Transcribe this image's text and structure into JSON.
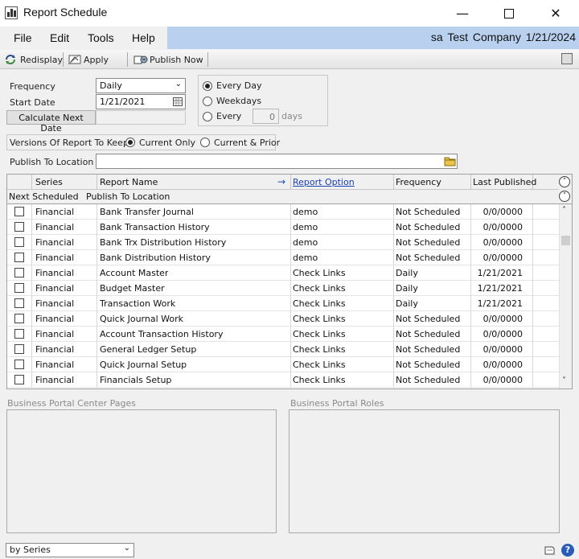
{
  "window": {
    "title": "Report Schedule"
  },
  "menu": {
    "file": "File",
    "edit": "Edit",
    "tools": "Tools",
    "help": "Help",
    "user_info": "sa  Test Company  1/21/2024"
  },
  "toolbar": {
    "redisplay": "Redisplay",
    "apply": "Apply",
    "publish_now": "Publish Now"
  },
  "form": {
    "frequency_label": "Frequency",
    "frequency_value": "Daily",
    "start_date_label": "Start Date",
    "start_date_value": "1/21/2021",
    "calc_next_date": "Calculate Next Date",
    "every_day": "Every Day",
    "weekdays": "Weekdays",
    "every": "Every",
    "every_days_value": "0",
    "days": "days",
    "versions_label": "Versions Of Report To Keep:",
    "current_only": "Current Only",
    "current_prior": "Current & Prior",
    "publish_location_label": "Publish To Location",
    "publish_location_value": ""
  },
  "grid": {
    "headers": {
      "series": "Series",
      "report_name": "Report Name",
      "report_option": "Report Option",
      "frequency": "Frequency",
      "last_published": "Last Published",
      "next_scheduled": "Next Scheduled",
      "publish_to_location": "Publish To Location"
    },
    "rows": [
      {
        "series": "Financial",
        "report": "Bank Transfer Journal",
        "option": "demo",
        "frequency": "Not Scheduled",
        "last": "0/0/0000"
      },
      {
        "series": "Financial",
        "report": "Bank Transaction History",
        "option": "demo",
        "frequency": "Not Scheduled",
        "last": "0/0/0000"
      },
      {
        "series": "Financial",
        "report": "Bank Trx Distribution History",
        "option": "demo",
        "frequency": "Not Scheduled",
        "last": "0/0/0000"
      },
      {
        "series": "Financial",
        "report": "Bank Distribution History",
        "option": "demo",
        "frequency": "Not Scheduled",
        "last": "0/0/0000"
      },
      {
        "series": "Financial",
        "report": "Account Master",
        "option": "Check Links",
        "frequency": "Daily",
        "last": "1/21/2021"
      },
      {
        "series": "Financial",
        "report": "Budget Master",
        "option": "Check Links",
        "frequency": "Daily",
        "last": "1/21/2021"
      },
      {
        "series": "Financial",
        "report": "Transaction Work",
        "option": "Check Links",
        "frequency": "Daily",
        "last": "1/21/2021"
      },
      {
        "series": "Financial",
        "report": "Quick Journal Work",
        "option": "Check Links",
        "frequency": "Not Scheduled",
        "last": "0/0/0000"
      },
      {
        "series": "Financial",
        "report": "Account Transaction History",
        "option": "Check Links",
        "frequency": "Not Scheduled",
        "last": "0/0/0000"
      },
      {
        "series": "Financial",
        "report": "General Ledger Setup",
        "option": "Check Links",
        "frequency": "Not Scheduled",
        "last": "0/0/0000"
      },
      {
        "series": "Financial",
        "report": "Quick Journal Setup",
        "option": "Check Links",
        "frequency": "Not Scheduled",
        "last": "0/0/0000"
      },
      {
        "series": "Financial",
        "report": "Financials Setup",
        "option": "Check Links",
        "frequency": "Not Scheduled",
        "last": "0/0/0000"
      }
    ]
  },
  "panels": {
    "center_pages": "Business Portal Center Pages",
    "roles": "Business Portal Roles"
  },
  "status": {
    "sort_by": "by Series"
  },
  "icons": [
    "redisplay-icon",
    "apply-icon",
    "publish-now-icon",
    "calendar-icon",
    "folder-icon",
    "expand-icon",
    "collapse-icon",
    "help-icon",
    "note-icon"
  ]
}
